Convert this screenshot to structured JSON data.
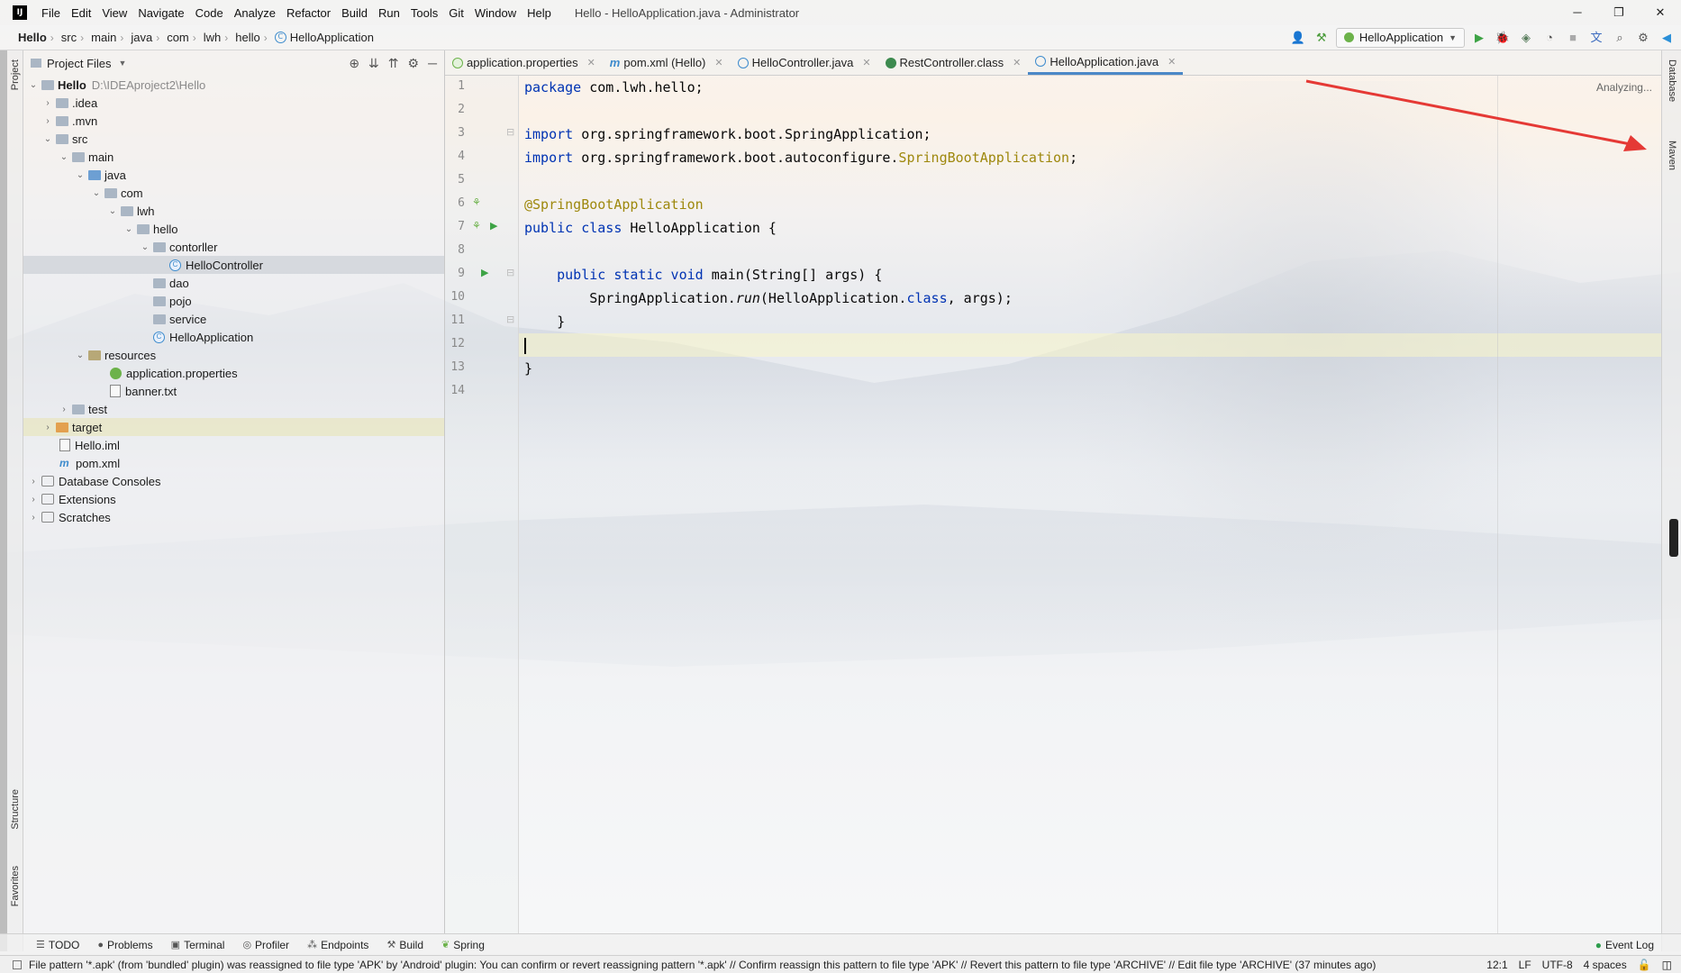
{
  "window": {
    "title": "Hello - HelloApplication.java - Administrator",
    "logo_text": "IJ",
    "menu": [
      "File",
      "Edit",
      "View",
      "Navigate",
      "Code",
      "Analyze",
      "Refactor",
      "Build",
      "Run",
      "Tools",
      "Git",
      "Window",
      "Help"
    ],
    "controls": {
      "minimize": "─",
      "restore": "❐",
      "close": "✕"
    }
  },
  "breadcrumb": [
    "Hello",
    "src",
    "main",
    "java",
    "com",
    "lwh",
    "hello",
    "HelloApplication"
  ],
  "toolbar": {
    "run_config": "HelloApplication"
  },
  "left_stripe": {
    "project": "Project",
    "structure": "Structure",
    "favorites": "Favorites"
  },
  "right_stripe": {
    "database": "Database",
    "maven": "Maven"
  },
  "project_panel": {
    "title": "Project Files",
    "root_name": "Hello",
    "root_path": "D:\\IDEAproject2\\Hello",
    "items": [
      {
        "label": ".idea"
      },
      {
        "label": ".mvn"
      },
      {
        "label": "src"
      },
      {
        "label": "main"
      },
      {
        "label": "java"
      },
      {
        "label": "com"
      },
      {
        "label": "lwh"
      },
      {
        "label": "hello"
      },
      {
        "label": "contorller"
      },
      {
        "label": "HelloController"
      },
      {
        "label": "dao"
      },
      {
        "label": "pojo"
      },
      {
        "label": "service"
      },
      {
        "label": "HelloApplication"
      },
      {
        "label": "resources"
      },
      {
        "label": "application.properties"
      },
      {
        "label": "banner.txt"
      },
      {
        "label": "test"
      },
      {
        "label": "target"
      },
      {
        "label": "Hello.iml"
      },
      {
        "label": "pom.xml"
      },
      {
        "label": "Database Consoles"
      },
      {
        "label": "Extensions"
      },
      {
        "label": "Scratches"
      }
    ]
  },
  "tabs": [
    {
      "label": "application.properties"
    },
    {
      "label": "pom.xml (Hello)"
    },
    {
      "label": "HelloController.java"
    },
    {
      "label": "RestController.class"
    },
    {
      "label": "HelloApplication.java"
    }
  ],
  "editor": {
    "analyzing": "Analyzing...",
    "line_numbers": [
      "1",
      "2",
      "3",
      "4",
      "5",
      "6",
      "7",
      "8",
      "9",
      "10",
      "11",
      "12",
      "13",
      "14"
    ],
    "code": {
      "l1_kw": "package",
      "l1_rest": " com.lwh.hello;",
      "l3_kw": "import",
      "l3_rest": " org.springframework.boot.SpringApplication;",
      "l4_kw": "import",
      "l4_rest": " org.springframework.boot.autoconfigure.",
      "l4_ann": "SpringBootApplication",
      "l4_end": ";",
      "l6_ann": "@SpringBootApplication",
      "l7_kw": "public class",
      "l7_rest": " HelloApplication {",
      "l9_indent": "    ",
      "l9_kw": "public static void",
      "l9_rest": " main(String[] args) {",
      "l10_pre": "        SpringApplication.",
      "l10_call": "run",
      "l10_mid": "(HelloApplication.",
      "l10_kw": "class",
      "l10_end": ", args);",
      "l11": "    }",
      "l13": "}"
    }
  },
  "bottom_tools": [
    "TODO",
    "Problems",
    "Terminal",
    "Profiler",
    "Endpoints",
    "Build",
    "Spring"
  ],
  "event_log": "Event Log",
  "status": {
    "message": "File pattern '*.apk' (from 'bundled' plugin) was reassigned to file type 'APK' by 'Android' plugin: You can confirm or revert reassigning pattern '*.apk' // Confirm reassign this pattern to file type 'APK' // Revert this pattern to file type 'ARCHIVE' // Edit file type 'ARCHIVE' (37 minutes ago)",
    "position": "12:1",
    "line_sep": "LF",
    "encoding": "UTF-8",
    "indent": "4 spaces"
  },
  "colors": {
    "keyword": "#0033b3",
    "annotation": "#9e880d",
    "accent": "#4a88c7",
    "arrow": "#e53935"
  }
}
